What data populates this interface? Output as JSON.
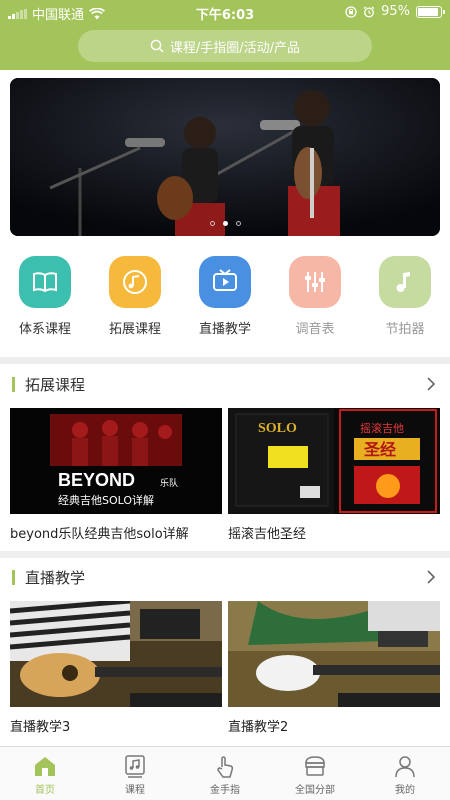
{
  "status_bar": {
    "carrier": "中国联通",
    "time": "下午6:03",
    "battery": "95%",
    "battery_level": 0.95,
    "icons": [
      "wifi-icon",
      "rotation-lock-icon",
      "alarm-icon",
      "battery-icon"
    ]
  },
  "search": {
    "placeholder": "课程/手指圈/活动/产品",
    "icon": "search-icon"
  },
  "banner": {
    "slide_count": 3,
    "active_slide": 2
  },
  "quick_menu": [
    {
      "label": "体系课程",
      "icon": "book-icon",
      "color": "#3cbfae"
    },
    {
      "label": "拓展课程",
      "icon": "music-disc-icon",
      "color": "#f6b93b"
    },
    {
      "label": "直播教学",
      "icon": "tv-play-icon",
      "color": "#4a90e2"
    },
    {
      "label": "调音表",
      "icon": "tuner-sliders-icon",
      "color": "#f6b7a6"
    },
    {
      "label": "节拍器",
      "icon": "music-note-icon",
      "color": "#c5db9f"
    }
  ],
  "sections": [
    {
      "title": "拓展课程",
      "items": [
        {
          "title": "beyond乐队经典吉他solo详解",
          "thumb_text": "BEYOND",
          "thumb_sub": "乐队",
          "thumb_caption": "经典吉他SOLO详解"
        },
        {
          "title": "摇滚吉他圣经",
          "thumb_text": "SOLO",
          "thumb_sub": "摇滚吉他",
          "thumb_caption": "圣经"
        }
      ]
    },
    {
      "title": "直播教学",
      "items": [
        {
          "title": "直播教学3"
        },
        {
          "title": "直播教学2"
        }
      ]
    }
  ],
  "tabbar": [
    {
      "label": "首页",
      "icon": "home-icon",
      "active": true
    },
    {
      "label": "课程",
      "icon": "music-sheet-icon",
      "active": false
    },
    {
      "label": "金手指",
      "icon": "finger-tap-icon",
      "active": false
    },
    {
      "label": "全国分部",
      "icon": "store-icon",
      "active": false
    },
    {
      "label": "我的",
      "icon": "user-icon",
      "active": false
    }
  ],
  "colors": {
    "accent": "#a3c45a",
    "text": "#333333"
  }
}
